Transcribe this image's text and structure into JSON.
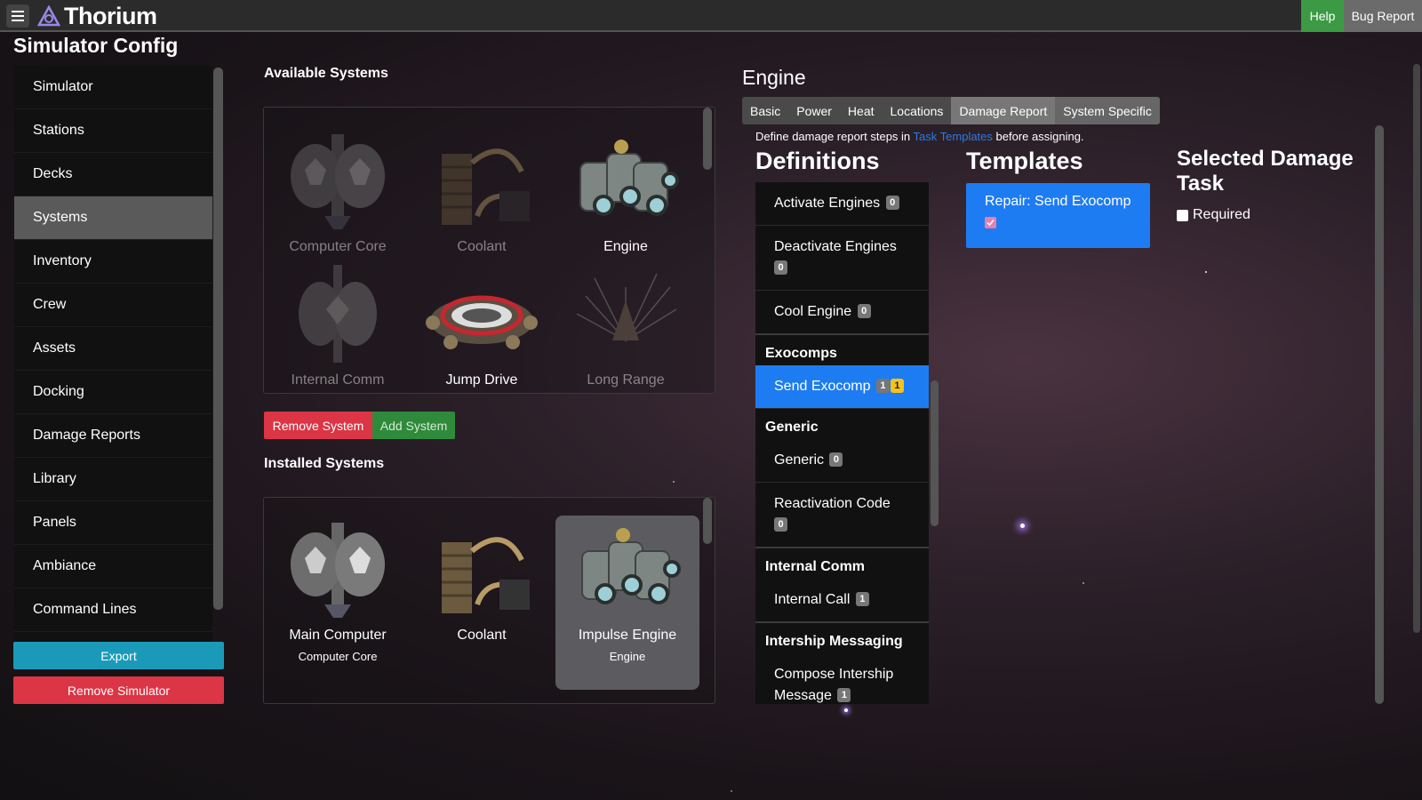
{
  "app": {
    "brand": "Thorium",
    "help_label": "Help",
    "bug_report_label": "Bug Report"
  },
  "page_title": "Simulator Config",
  "sidebar": {
    "items": [
      {
        "label": "Simulator"
      },
      {
        "label": "Stations"
      },
      {
        "label": "Decks"
      },
      {
        "label": "Systems"
      },
      {
        "label": "Inventory"
      },
      {
        "label": "Crew"
      },
      {
        "label": "Assets"
      },
      {
        "label": "Docking"
      },
      {
        "label": "Damage Reports"
      },
      {
        "label": "Library"
      },
      {
        "label": "Panels"
      },
      {
        "label": "Ambiance"
      },
      {
        "label": "Command Lines"
      }
    ],
    "active_index": 3,
    "export_label": "Export",
    "remove_simulator_label": "Remove Simulator"
  },
  "available": {
    "heading": "Available Systems",
    "items": [
      {
        "label": "Computer Core",
        "icon": "computer-core-icon"
      },
      {
        "label": "Coolant",
        "icon": "coolant-icon"
      },
      {
        "label": "Engine",
        "icon": "engine-icon"
      },
      {
        "label": "Internal Comm",
        "icon": "internal-comm-icon"
      },
      {
        "label": "Jump Drive",
        "icon": "jump-drive-icon"
      },
      {
        "label": "Long Range",
        "icon": "long-range-icon"
      }
    ],
    "remove_label": "Remove System",
    "add_label": "Add System"
  },
  "installed": {
    "heading": "Installed Systems",
    "items": [
      {
        "label": "Main Computer",
        "sub": "Computer Core",
        "icon": "computer-core-icon"
      },
      {
        "label": "Coolant",
        "sub": "",
        "icon": "coolant-icon"
      },
      {
        "label": "Impulse Engine",
        "sub": "Engine",
        "icon": "engine-icon"
      }
    ]
  },
  "engine": {
    "title": "Engine",
    "tabs": [
      "Basic",
      "Power",
      "Heat",
      "Locations",
      "Damage Report",
      "System Specific"
    ],
    "active_tab": "Damage Report",
    "hint_prefix": "Define damage report steps in",
    "hint_link": "Task Templates",
    "hint_suffix": "before assigning.",
    "definitions_heading": "Definitions",
    "templates_heading": "Templates",
    "selected_heading": "Selected Damage Task",
    "required_label": "Required",
    "definitions": {
      "ungrouped": [
        {
          "label": "Activate Engines",
          "count": "0"
        },
        {
          "label": "Deactivate Engines",
          "count": "0"
        },
        {
          "label": "Cool Engine",
          "count": "0"
        }
      ],
      "exocomps_group": "Exocomps",
      "send_exocomp": {
        "label": "Send Exocomp",
        "count": "1",
        "assigned": "1"
      },
      "generic_group": "Generic",
      "generic": [
        {
          "label": "Generic",
          "count": "0"
        },
        {
          "label": "Reactivation Code",
          "count": "0"
        }
      ],
      "internal_comm_group": "Internal Comm",
      "internal_call": {
        "label": "Internal Call",
        "count": "1"
      },
      "intership_group": "Intership Messaging",
      "compose": {
        "label": "Compose Intership Message",
        "count": "1"
      }
    },
    "template_card": {
      "label": "Repair: Send Exocomp",
      "checked": true
    }
  },
  "colors": {
    "primary": "#1e7cf2",
    "danger": "#dc3545",
    "success": "#3c9a45",
    "info": "#1a9ab8",
    "warning_badge": "#f4c31b"
  }
}
